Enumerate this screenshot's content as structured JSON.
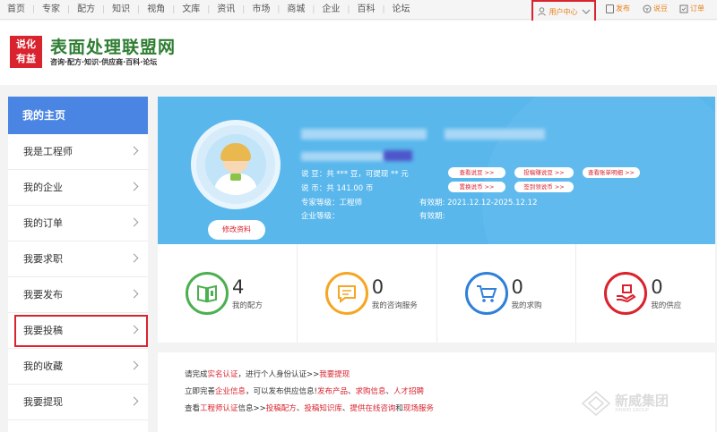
{
  "topnav": {
    "items": [
      "首页",
      "专家",
      "配方",
      "知识",
      "视角",
      "文库",
      "资讯",
      "市场",
      "商城",
      "企业",
      "百科",
      "论坛"
    ],
    "user_center": "用户中心",
    "publish": "发布",
    "shuodou": "说豆",
    "orders": "订单"
  },
  "header": {
    "logo_text_1": "说化",
    "logo_text_2": "有益",
    "site_title": "表面处理联盟网",
    "site_subtitle": "咨询·配方·知识·供应商·百科·论坛"
  },
  "sidebar": {
    "title": "我的主页",
    "items": [
      "我是工程师",
      "我的企业",
      "我的订单",
      "我要求职",
      "我要发布",
      "我要投稿",
      "我的收藏",
      "我要提现"
    ]
  },
  "profile": {
    "edit_button": "修改资料",
    "shuodou_line": "说 豆：共 *** 豆，可提现 ** 元",
    "shuobi_line": "说 币：共 141.00 币",
    "expert_level_label": "专家等级：",
    "expert_level_value": "工程师",
    "company_level_label": "企业等级：",
    "validity_label_1": "有效期:",
    "validity_value_1": "2021.12.12-2025.12.12",
    "validity_label_2": "有效期:",
    "buttons": {
      "view_dou": "查看说豆 >>",
      "post_earn": "投稿赚说豆 >>",
      "view_bill": "查看账单明细 >>",
      "exchange": "置换说币 >>",
      "signin": "签到领说币 >>"
    }
  },
  "stats": [
    {
      "value": "4",
      "label": "我的配方",
      "color": "#4caf50"
    },
    {
      "value": "0",
      "label": "我的咨询服务",
      "color": "#f5a623"
    },
    {
      "value": "0",
      "label": "我的求购",
      "color": "#2f80d9"
    },
    {
      "value": "0",
      "label": "我的供应",
      "color": "#d9232e"
    }
  ],
  "notice": {
    "l1_a": "请完成",
    "l1_link1": "实名认证",
    "l1_b": "，进行个人身份认证>>",
    "l1_link2": "我要提现",
    "l2_a": "立即完善",
    "l2_link1": "企业信息",
    "l2_b": "，可以发布供应信息!",
    "l2_link2": "发布产品",
    "l2_sep1": "、",
    "l2_link3": "求购信息",
    "l2_sep2": "、",
    "l2_link4": "人才招聘",
    "l3_a": "查看",
    "l3_link1": "工程师认证",
    "l3_b": "信息>>",
    "l3_link2": "投稿配方",
    "l3_sep1": "、",
    "l3_link3": "投稿知识库",
    "l3_sep2": "、",
    "l3_link4": "提供在线咨询",
    "l3_c": "和",
    "l3_link5": "现场服务"
  },
  "watermark": {
    "text": "新威集团",
    "sub": "XINWEI GROUP"
  },
  "colors": {
    "accent_blue": "#4a85e4",
    "banner_blue": "#59b7ec",
    "brand_red": "#d9232e",
    "brand_green": "#2e7d32"
  }
}
